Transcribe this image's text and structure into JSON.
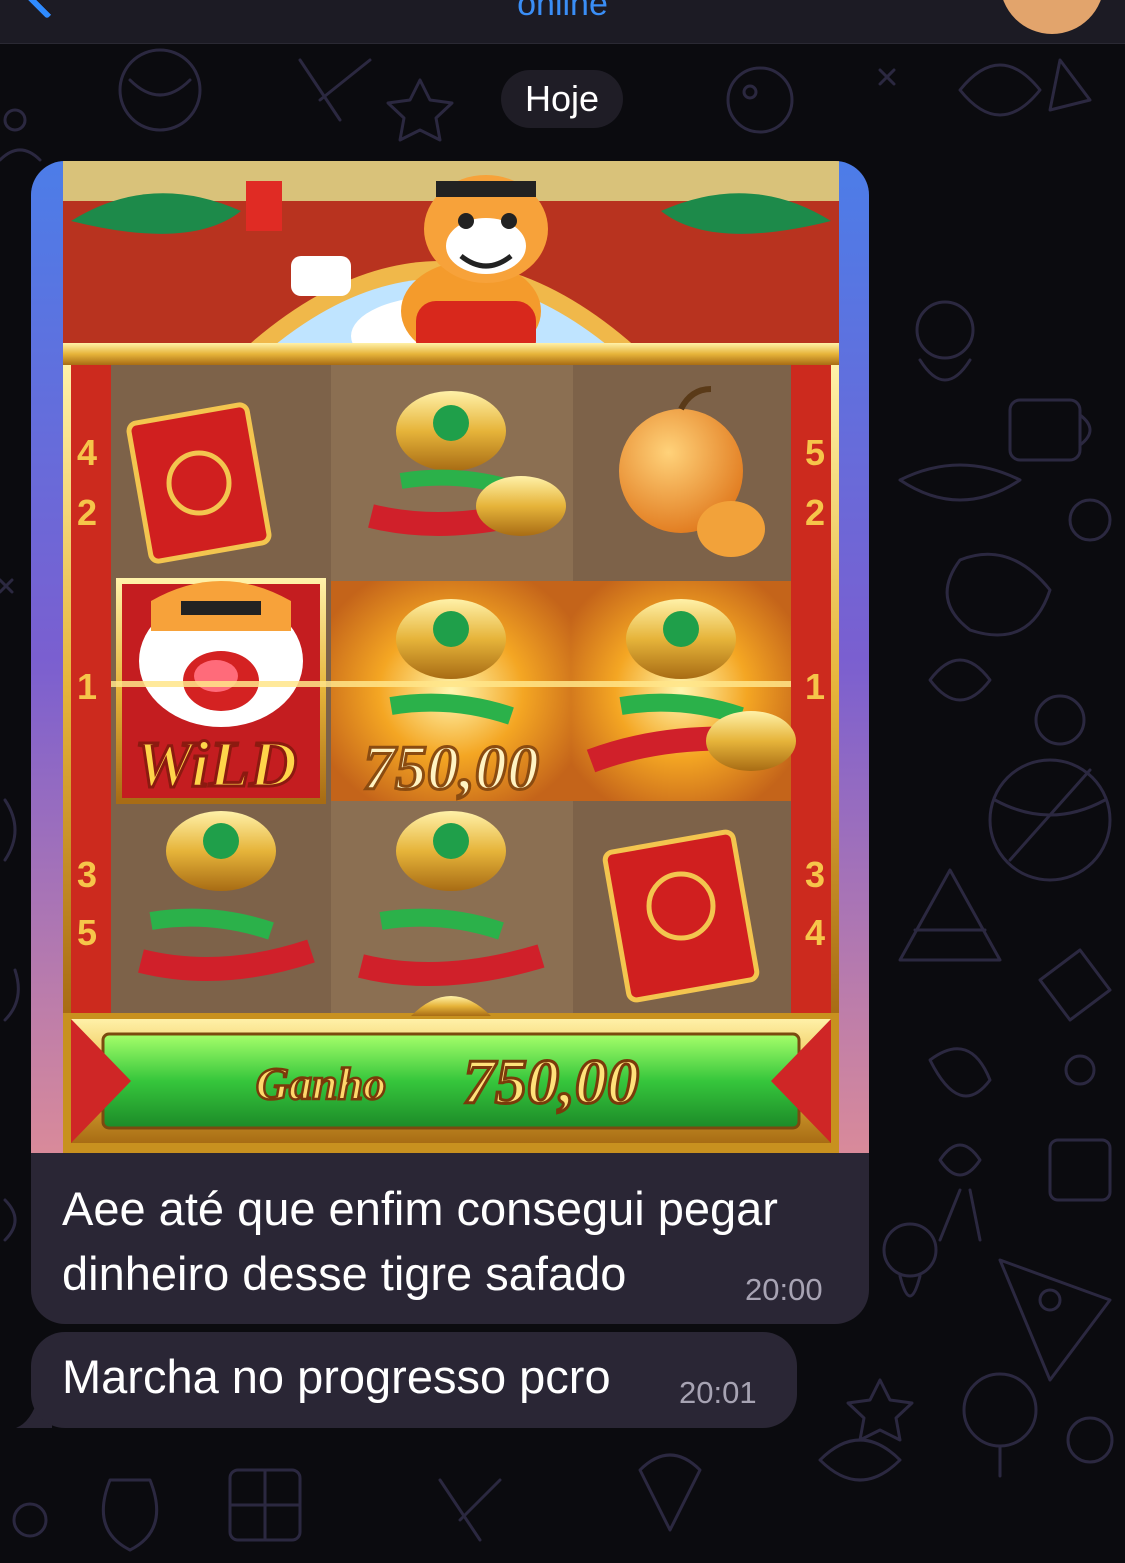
{
  "header": {
    "status": "online",
    "back_icon": "chevron-left-icon",
    "avatar": "contact-avatar"
  },
  "date_separator": "Hoje",
  "messages": [
    {
      "type": "image",
      "caption": "Aee até que enfim consegui pegar dinheiro desse tigre safado",
      "caption_lines": [
        "Aee até que enfim consegui pegar",
        "dinheiro desse tigre safado"
      ],
      "time": "20:00",
      "image": {
        "wild_label": "WiLD",
        "line_win": "750,00",
        "win_banner_label": "Ganho",
        "win_banner_amount": "750,00",
        "left_pillar_numbers": [
          "4",
          "2",
          "1",
          "3",
          "5"
        ],
        "right_pillar_numbers": [
          "5",
          "2",
          "1",
          "3",
          "4"
        ],
        "symbols": [
          [
            "red-envelope",
            "gold-ingot",
            "orange"
          ],
          [
            "tiger-wild",
            "gold-ingot",
            "gold-ingot"
          ],
          [
            "gold-ingot",
            "gold-ingot",
            "red-envelope"
          ]
        ]
      }
    },
    {
      "type": "text",
      "text": "Marcha no progresso pcro",
      "time": "20:01"
    }
  ],
  "colors": {
    "background": "#0b0b0f",
    "bubble": "#2a2635",
    "accent": "#3a8ef6",
    "timestamp": "#a7a3b3"
  }
}
